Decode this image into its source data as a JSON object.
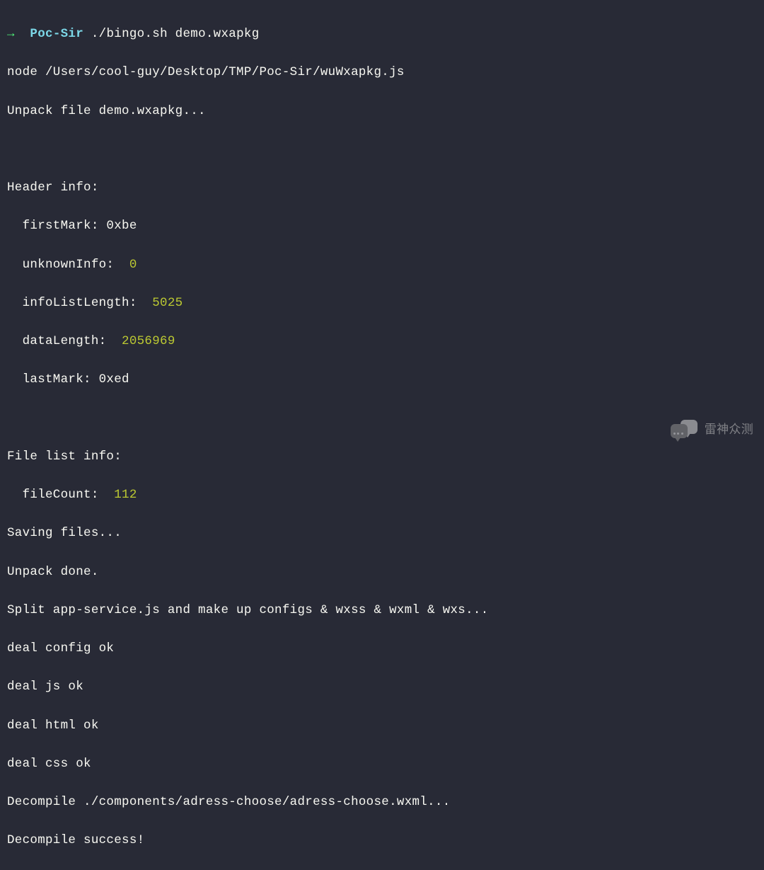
{
  "prompt": {
    "arrow": "→",
    "label": "Poc-Sir",
    "command": "./bingo.sh demo.wxapkg"
  },
  "lines": {
    "node_path": "node /Users/cool-guy/Desktop/TMP/Poc-Sir/wuWxapkg.js",
    "unpack_file": "Unpack file demo.wxapkg...",
    "header_info": "Header info:",
    "first_mark_label": "  firstMark: 0xbe",
    "unknown_info_label": "  unknownInfo:  ",
    "unknown_info_value": "0",
    "info_list_label": "  infoListLength:  ",
    "info_list_value": "5025",
    "data_length_label": "  dataLength:  ",
    "data_length_value": "2056969",
    "last_mark": "  lastMark: 0xed",
    "file_list_info": "File list info:",
    "file_count_label": "  fileCount:  ",
    "file_count_value": "112",
    "saving_files": "Saving files...",
    "unpack_done": "Unpack done.",
    "split_line": "Split app-service.js and make up configs & wxss & wxml & wxs...",
    "deal_config": "deal config ok",
    "deal_js": "deal js ok",
    "deal_html": "deal html ok",
    "deal_css": "deal css ok",
    "decompile": "Decompile ./components/adress-choose/adress-choose.wxml...",
    "decompile_success": "Decompile success!"
  },
  "watermark": {
    "text": "雷神众测"
  }
}
